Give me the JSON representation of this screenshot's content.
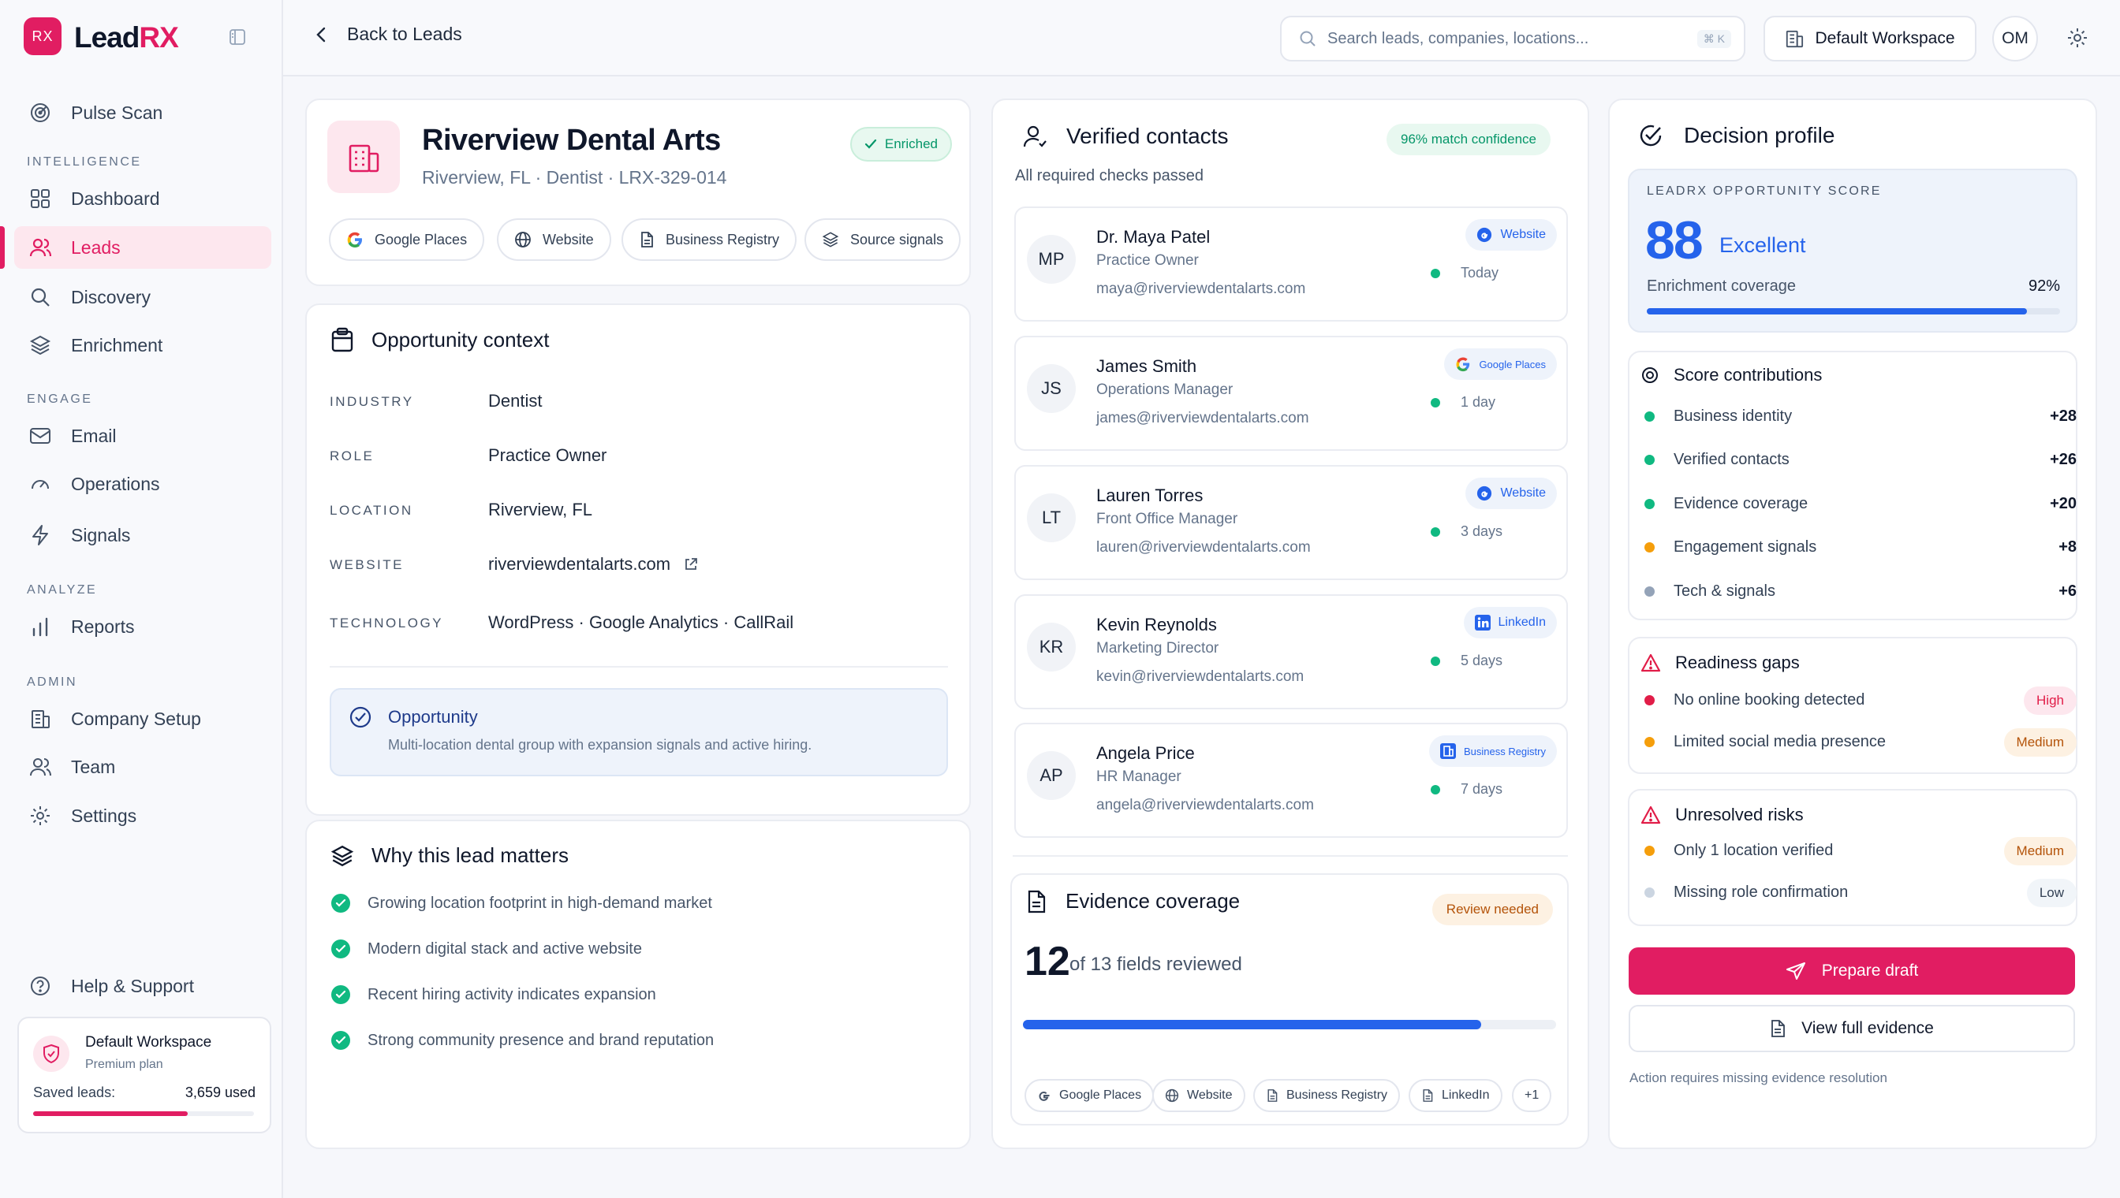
{
  "app": {
    "logo_mark": "RX",
    "name_a": "Lead",
    "name_b": "RX"
  },
  "sidebar": {
    "items": [
      {
        "label": "Pulse Scan"
      },
      {
        "label": "Dashboard"
      },
      {
        "label": "Leads"
      },
      {
        "label": "Discovery"
      },
      {
        "label": "Enrichment"
      },
      {
        "label": "Email"
      },
      {
        "label": "Operations"
      },
      {
        "label": "Signals"
      },
      {
        "label": "Reports"
      },
      {
        "label": "Company Setup"
      },
      {
        "label": "Team"
      },
      {
        "label": "Settings"
      },
      {
        "label": "Help & Support"
      }
    ],
    "sections": {
      "intelligence": "INTELLIGENCE",
      "engage": "ENGAGE",
      "analyze": "ANALYZE",
      "admin": "ADMIN"
    },
    "workspace": {
      "name": "Default Workspace",
      "plan": "Premium plan",
      "saved_label": "Saved leads:",
      "saved_value": "3,659 used",
      "usage_fraction": 0.7
    }
  },
  "topbar": {
    "back_label": "Back to Leads",
    "search_placeholder": "Search leads, companies, locations...",
    "search_shortcut": "⌘ K",
    "workspace_label": "Default Workspace",
    "user_initials": "OM"
  },
  "lead": {
    "name": "Riverview Dental Arts",
    "subtitle": "Riverview, FL · Dentist · LRX-329-014",
    "status": "Enriched",
    "sources": [
      "Google Places",
      "Website",
      "Business Registry",
      "Source signals"
    ]
  },
  "context": {
    "title": "Opportunity context",
    "fields": [
      {
        "key": "INDUSTRY",
        "value": "Dentist"
      },
      {
        "key": "ROLE",
        "value": "Practice Owner"
      },
      {
        "key": "LOCATION",
        "value": "Riverview, FL"
      },
      {
        "key": "WEBSITE",
        "value": "riverviewdentalarts.com"
      },
      {
        "key": "TECHNOLOGY",
        "value": "WordPress · Google Analytics · CallRail"
      }
    ],
    "opportunity_title": "Opportunity",
    "opportunity_text": "Multi-location dental group with expansion signals and active hiring."
  },
  "why": {
    "title": "Why this lead matters",
    "points": [
      "Growing location footprint in high-demand market",
      "Modern digital stack and active website",
      "Recent hiring activity indicates expansion",
      "Strong community presence and brand reputation"
    ]
  },
  "contacts": {
    "title": "Verified contacts",
    "confidence": "96% match confidence",
    "subtitle": "All required checks passed",
    "list": [
      {
        "initials": "MP",
        "name": "Dr. Maya Patel",
        "role": "Practice Owner",
        "email": "maya@riverviewdentalarts.com",
        "source": "Website",
        "source_icon": "globe-icon",
        "time": "Today"
      },
      {
        "initials": "JS",
        "name": "James Smith",
        "role": "Operations Manager",
        "email": "james@riverviewdentalarts.com",
        "source": "Google Places",
        "source_icon": "google-icon",
        "time": "1 day"
      },
      {
        "initials": "LT",
        "name": "Lauren Torres",
        "role": "Front Office Manager",
        "email": "lauren@riverviewdentalarts.com",
        "source": "Website",
        "source_icon": "globe-icon",
        "time": "3 days"
      },
      {
        "initials": "KR",
        "name": "Kevin Reynolds",
        "role": "Marketing Director",
        "email": "kevin@riverviewdentalarts.com",
        "source": "LinkedIn",
        "source_icon": "linkedin-icon",
        "time": "5 days"
      },
      {
        "initials": "AP",
        "name": "Angela Price",
        "role": "HR Manager",
        "email": "angela@riverviewdentalarts.com",
        "source": "Business Registry",
        "source_icon": "building-icon",
        "time": "7 days"
      }
    ]
  },
  "evidence": {
    "title": "Evidence coverage",
    "status": "Review needed",
    "count": "12",
    "count_text": "of 13 fields reviewed",
    "progress": 0.86,
    "sources": [
      "Google Places",
      "Website",
      "Business Registry",
      "LinkedIn",
      "+1"
    ]
  },
  "decision": {
    "title": "Decision profile",
    "score_label": "LEADRX OPPORTUNITY SCORE",
    "score": "88",
    "score_word": "Excellent",
    "coverage_label": "Enrichment coverage",
    "coverage_value": "92%",
    "coverage_fraction": 0.92,
    "contrib_title": "Score contributions",
    "contributions": [
      {
        "label": "Business identity",
        "value": "+28",
        "color": "#10b981"
      },
      {
        "label": "Verified contacts",
        "value": "+26",
        "color": "#10b981"
      },
      {
        "label": "Evidence coverage",
        "value": "+20",
        "color": "#10b981"
      },
      {
        "label": "Engagement signals",
        "value": "+8",
        "color": "#f59e0b"
      },
      {
        "label": "Tech & signals",
        "value": "+6",
        "color": "#94a3b8"
      }
    ],
    "gaps_title": "Readiness gaps",
    "gaps": [
      {
        "label": "No online booking detected",
        "level": "High"
      },
      {
        "label": "Limited social media presence",
        "level": "Medium"
      }
    ],
    "risks_title": "Unresolved risks",
    "risks": [
      {
        "label": "Only 1 location verified",
        "level": "Medium"
      },
      {
        "label": "Missing role confirmation",
        "level": "Low"
      }
    ],
    "primary_action": "Prepare draft",
    "secondary_action": "View full evidence",
    "note": "Action requires missing evidence resolution"
  },
  "colors": {
    "brand": "#e11d62",
    "accent_blue": "#2563eb",
    "success": "#10b981",
    "warning": "#f59e0b"
  }
}
